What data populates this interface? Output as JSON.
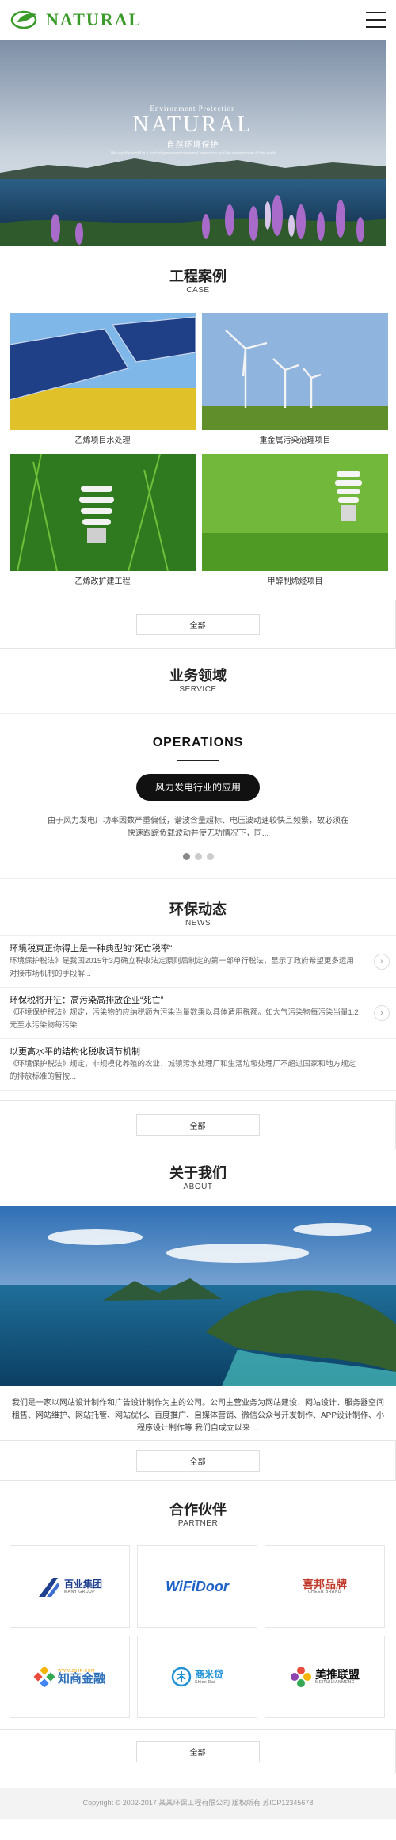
{
  "header": {
    "logo_text": "NATURAL"
  },
  "banner": {
    "small": "Environment Protection",
    "big": "NATURAL",
    "cn": "自然环境保护",
    "sub": "We see the world in a kind of green environmental protection and the environment of the earth"
  },
  "cases": {
    "title": "工程案例",
    "subtitle": "CASE",
    "items": [
      {
        "caption": "乙烯项目水处理"
      },
      {
        "caption": "重金属污染治理项目"
      },
      {
        "caption": "乙烯改扩建工程"
      },
      {
        "caption": "甲醇制烯烃项目"
      }
    ],
    "more": "全部"
  },
  "service": {
    "title": "业务领域",
    "subtitle": "SERVICE",
    "heading": "OPERATIONS",
    "pill": "风力发电行业的应用",
    "desc": "由于风力发电厂功率因数严重偏低，谐波含量超标、电压波动速较快且频繁，故必须在快速跟踪负载波动并使无功情况下，同...",
    "slides": 3,
    "active_slide": 0
  },
  "news": {
    "title": "环保动态",
    "subtitle": "NEWS",
    "items": [
      {
        "title": "环境税真正你得上是一种典型的“死亡税率”",
        "desc": "环境保护税法》是我国2015年3月确立税收法定原则后制定的第一部单行税法，显示了政府希望更多运用对接市场机制的手段解..."
      },
      {
        "title": "环保税将开征：高污染高排放企业“死亡”",
        "desc": "《环境保护税法》规定，污染物的应纳税额为污染当量数乘以具体适用税额。如大气污染物每污染当量1.2元至水污染物每污染..."
      },
      {
        "title": "以更高水平的结构化税收调节机制",
        "desc": "《环境保护税法》规定，非规模化养殖的农业、城镇污水处理厂和生活垃圾处理厂不超过国家和地方规定的排放标准的暂按..."
      }
    ],
    "more": "全部"
  },
  "about": {
    "title": "关于我们",
    "subtitle": "ABOUT",
    "text": "我们是一家以网站设计制作和广告设计制作为主的公司。公司主营业务为网站建设、网站设计、服务器空间租售、网站维护、网站托管、网站优化、百度推广、自媒体营销、微信公众号开发制作、APP设计制作、小程序设计制作等 我们自成立以来 ...",
    "more": "全部"
  },
  "partners": {
    "title": "合作伙伴",
    "subtitle": "PARTNER",
    "items": [
      {
        "name": "百业集团",
        "sub": "MANY GROUP",
        "color": "#1f3f8f"
      },
      {
        "name": "WiFiDoor",
        "sub": "",
        "color": "#1e62c8"
      },
      {
        "name": "喜邦品牌",
        "sub": "CHEER BRAND",
        "color": "#c0392b"
      },
      {
        "name": "知商金融",
        "sub": "WWW.ZSJR.COM",
        "color": "#2d6fb8"
      },
      {
        "name": "商米贷",
        "sub": "Shimi Dai",
        "color": "#1e90d6"
      },
      {
        "name": "美推联盟",
        "sub": "MEITUILIANMENG",
        "color": "#111111"
      }
    ],
    "more": "全部"
  },
  "footer": {
    "text": "Copyright © 2002-2017 某某环保工程有限公司 版权所有 苏ICP12345678"
  }
}
